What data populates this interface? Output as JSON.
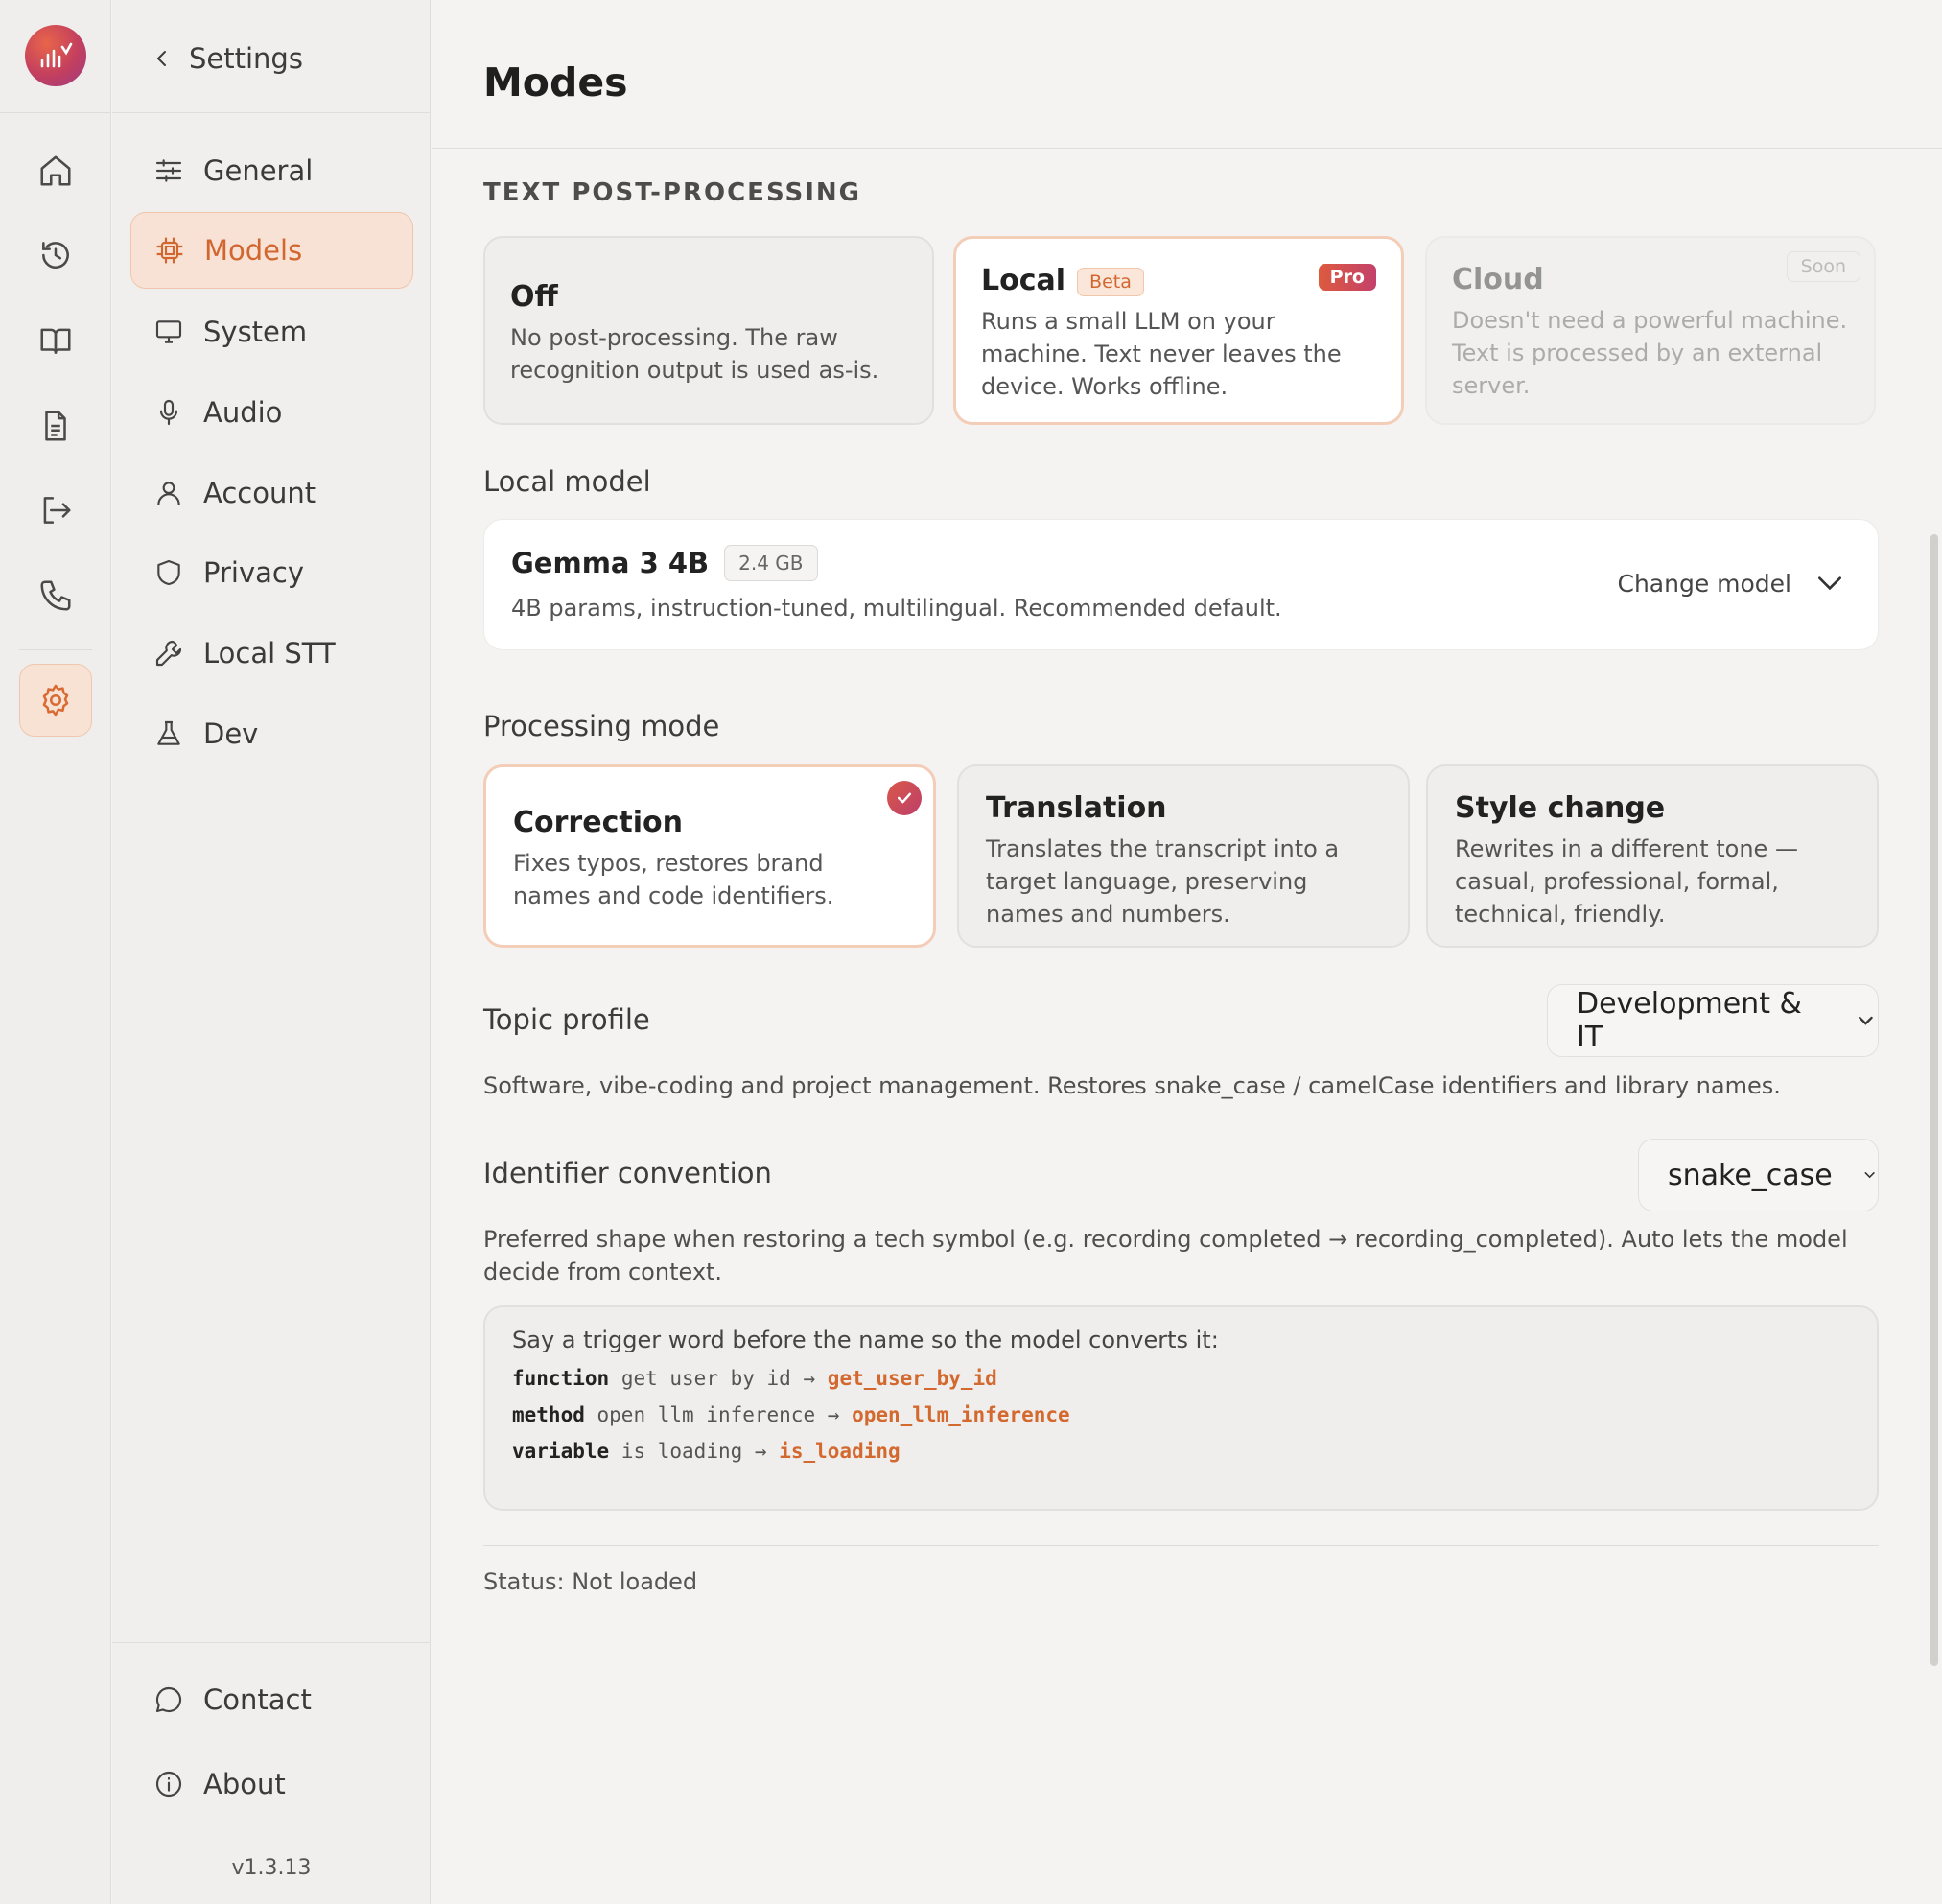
{
  "nav": {
    "back_label": "Settings",
    "items": [
      {
        "label": "General"
      },
      {
        "label": "Models"
      },
      {
        "label": "System"
      },
      {
        "label": "Audio"
      },
      {
        "label": "Account"
      },
      {
        "label": "Privacy"
      },
      {
        "label": "Local STT"
      },
      {
        "label": "Dev"
      }
    ],
    "bottom": [
      {
        "label": "Contact"
      },
      {
        "label": "About"
      }
    ],
    "version": "v1.3.13",
    "active": "Models"
  },
  "rail_icons": [
    "home-icon",
    "history-icon",
    "book-icon",
    "document-icon",
    "import-icon",
    "phone-icon",
    "gear-icon"
  ],
  "page": {
    "title": "Modes"
  },
  "post_processing": {
    "section_label": "TEXT POST-PROCESSING",
    "selected": "Local",
    "options": [
      {
        "title": "Off",
        "desc": "No post-processing. The raw recognition output is used as-is."
      },
      {
        "title": "Local",
        "badge": "Beta",
        "tag": "Pro",
        "desc": "Runs a small LLM on your machine. Text never leaves the device. Works offline."
      },
      {
        "title": "Cloud",
        "tag": "Soon",
        "desc": "Doesn't need a powerful machine. Text is processed by an external server."
      }
    ]
  },
  "local_model": {
    "label": "Local model",
    "name": "Gemma 3 4B",
    "size": "2.4 GB",
    "desc": "4B params, instruction-tuned, multilingual. Recommended default.",
    "change_label": "Change model"
  },
  "processing_mode": {
    "label": "Processing mode",
    "selected": "Correction",
    "modes": [
      {
        "title": "Correction",
        "desc": "Fixes typos, restores brand names and code identifiers."
      },
      {
        "title": "Translation",
        "desc": "Translates the transcript into a target language, preserving names and numbers."
      },
      {
        "title": "Style change",
        "desc": "Rewrites in a different tone — casual, professional, formal, technical, friendly."
      }
    ]
  },
  "topic_profile": {
    "label": "Topic profile",
    "value": "Development & IT",
    "desc": "Software, vibe-coding and project management. Restores snake_case / camelCase identifiers and library names."
  },
  "identifier_convention": {
    "label": "Identifier convention",
    "value": "snake_case",
    "desc": "Preferred shape when restoring a tech symbol (e.g. recording completed → recording_completed). Auto lets the model decide from context."
  },
  "trigger_box": {
    "intro": "Say a trigger word before the name so the model converts it:",
    "examples": [
      {
        "keyword": "function",
        "phrase": "get user by id",
        "arrow": "→",
        "result": "get_user_by_id"
      },
      {
        "keyword": "method",
        "phrase": "open llm inference",
        "arrow": "→",
        "result": "open_llm_inference"
      },
      {
        "keyword": "variable",
        "phrase": "is loading",
        "arrow": "→",
        "result": "is_loading"
      }
    ]
  },
  "status": {
    "text": "Status: Not loaded"
  },
  "colors": {
    "accent": "#d2662f",
    "accent_bg": "#f8e2d5",
    "pro_gradient_start": "#dd5a3e",
    "pro_gradient_end": "#c3416a"
  }
}
